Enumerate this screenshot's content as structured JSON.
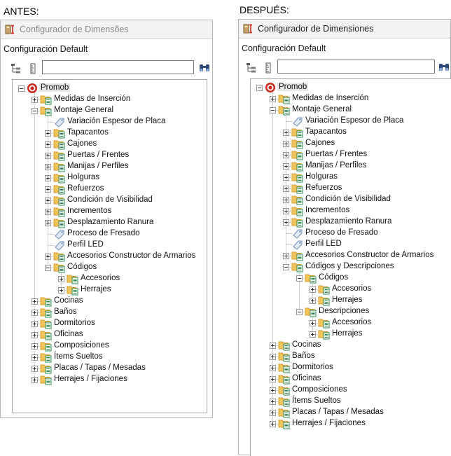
{
  "labels": {
    "before": "ANTES:",
    "after": "DESPUÉS:"
  },
  "window_title": "Configurador de Dimensões",
  "window_title_after": "Configurador de Dimensiones",
  "section_label": "Configuración Default",
  "search": {
    "value": "",
    "placeholder": ""
  },
  "toolbar": {
    "left_icon": "tree-structure-icon",
    "middle_icon": "ruler-icon",
    "find_icon": "binoculars-icon"
  },
  "colors": {
    "folder": "#f2c55c",
    "folder_dark": "#d39e2c",
    "doc_green": "#2d8a4e",
    "root_red": "#d0281c",
    "tag_blue": "#6f8fb8"
  },
  "before_tree": [
    {
      "depth": 0,
      "label": "Promob",
      "type": "root",
      "exp": "minus"
    },
    {
      "depth": 1,
      "label": "Medidas de Inserción",
      "type": "folder",
      "exp": "plus"
    },
    {
      "depth": 1,
      "label": "Montaje General",
      "type": "folder",
      "exp": "minus"
    },
    {
      "depth": 2,
      "label": "Variación Espesor de Placa",
      "type": "tag",
      "exp": ""
    },
    {
      "depth": 2,
      "label": "Tapacantos",
      "type": "folder",
      "exp": "plus"
    },
    {
      "depth": 2,
      "label": "Cajones",
      "type": "folder",
      "exp": "plus"
    },
    {
      "depth": 2,
      "label": "Puertas / Frentes",
      "type": "folder",
      "exp": "plus"
    },
    {
      "depth": 2,
      "label": "Manijas / Perfiles",
      "type": "folder",
      "exp": "plus"
    },
    {
      "depth": 2,
      "label": "Holguras",
      "type": "folder",
      "exp": "plus"
    },
    {
      "depth": 2,
      "label": "Refuerzos",
      "type": "folder",
      "exp": "plus"
    },
    {
      "depth": 2,
      "label": "Condición de Visibilidad",
      "type": "folder",
      "exp": "plus"
    },
    {
      "depth": 2,
      "label": "Incrementos",
      "type": "folder",
      "exp": "plus"
    },
    {
      "depth": 2,
      "label": "Desplazamiento Ranura",
      "type": "folder",
      "exp": "plus"
    },
    {
      "depth": 2,
      "label": "Proceso de Fresado",
      "type": "tag",
      "exp": ""
    },
    {
      "depth": 2,
      "label": "Perfil LED",
      "type": "tag",
      "exp": ""
    },
    {
      "depth": 2,
      "label": "Accesorios Constructor de Armarios",
      "type": "folder",
      "exp": "plus"
    },
    {
      "depth": 2,
      "label": "Códigos",
      "type": "folder",
      "exp": "minus"
    },
    {
      "depth": 3,
      "label": "Accesorios",
      "type": "folder",
      "exp": "plus"
    },
    {
      "depth": 3,
      "label": "Herrajes",
      "type": "folder",
      "exp": "plus"
    },
    {
      "depth": 1,
      "label": "Cocinas",
      "type": "folder",
      "exp": "plus"
    },
    {
      "depth": 1,
      "label": "Baños",
      "type": "folder",
      "exp": "plus"
    },
    {
      "depth": 1,
      "label": "Dormitorios",
      "type": "folder",
      "exp": "plus"
    },
    {
      "depth": 1,
      "label": "Oficinas",
      "type": "folder",
      "exp": "plus"
    },
    {
      "depth": 1,
      "label": "Composiciones",
      "type": "folder",
      "exp": "plus"
    },
    {
      "depth": 1,
      "label": "Ítems Sueltos",
      "type": "folder",
      "exp": "plus"
    },
    {
      "depth": 1,
      "label": "Placas / Tapas / Mesadas",
      "type": "folder",
      "exp": "plus"
    },
    {
      "depth": 1,
      "label": "Herrajes / Fijaciones",
      "type": "folder",
      "exp": "plus"
    }
  ],
  "after_tree": [
    {
      "depth": 0,
      "label": "Promob",
      "type": "root",
      "exp": "minus"
    },
    {
      "depth": 1,
      "label": "Medidas de Inserción",
      "type": "folder",
      "exp": "plus"
    },
    {
      "depth": 1,
      "label": "Montaje General",
      "type": "folder",
      "exp": "minus"
    },
    {
      "depth": 2,
      "label": "Variación Espesor de Placa",
      "type": "tag",
      "exp": ""
    },
    {
      "depth": 2,
      "label": "Tapacantos",
      "type": "folder",
      "exp": "plus"
    },
    {
      "depth": 2,
      "label": "Cajones",
      "type": "folder",
      "exp": "plus"
    },
    {
      "depth": 2,
      "label": "Puertas / Frentes",
      "type": "folder",
      "exp": "plus"
    },
    {
      "depth": 2,
      "label": "Manijas / Perfiles",
      "type": "folder",
      "exp": "plus"
    },
    {
      "depth": 2,
      "label": "Holguras",
      "type": "folder",
      "exp": "plus"
    },
    {
      "depth": 2,
      "label": "Refuerzos",
      "type": "folder",
      "exp": "plus"
    },
    {
      "depth": 2,
      "label": "Condición de Visibilidad",
      "type": "folder",
      "exp": "plus"
    },
    {
      "depth": 2,
      "label": "Incrementos",
      "type": "folder",
      "exp": "plus"
    },
    {
      "depth": 2,
      "label": "Desplazamiento Ranura",
      "type": "folder",
      "exp": "plus"
    },
    {
      "depth": 2,
      "label": "Proceso de Fresado",
      "type": "tag",
      "exp": ""
    },
    {
      "depth": 2,
      "label": "Perfil LED",
      "type": "tag",
      "exp": ""
    },
    {
      "depth": 2,
      "label": "Accesorios Constructor de Armarios",
      "type": "folder",
      "exp": "plus"
    },
    {
      "depth": 2,
      "label": "Códigos y Descripciones",
      "type": "folder",
      "exp": "minus"
    },
    {
      "depth": 3,
      "label": "Códigos",
      "type": "folder",
      "exp": "minus"
    },
    {
      "depth": 4,
      "label": "Accesorios",
      "type": "folder",
      "exp": "plus"
    },
    {
      "depth": 4,
      "label": "Herrajes",
      "type": "folder",
      "exp": "plus"
    },
    {
      "depth": 3,
      "label": "Descripciones",
      "type": "folder",
      "exp": "minus"
    },
    {
      "depth": 4,
      "label": "Accesorios",
      "type": "folder",
      "exp": "plus"
    },
    {
      "depth": 4,
      "label": "Herrajes",
      "type": "folder",
      "exp": "plus"
    },
    {
      "depth": 1,
      "label": "Cocinas",
      "type": "folder",
      "exp": "plus"
    },
    {
      "depth": 1,
      "label": "Baños",
      "type": "folder",
      "exp": "plus"
    },
    {
      "depth": 1,
      "label": "Dormitorios",
      "type": "folder",
      "exp": "plus"
    },
    {
      "depth": 1,
      "label": "Oficinas",
      "type": "folder",
      "exp": "plus"
    },
    {
      "depth": 1,
      "label": "Composiciones",
      "type": "folder",
      "exp": "plus"
    },
    {
      "depth": 1,
      "label": "Ítems Sueltos",
      "type": "folder",
      "exp": "plus"
    },
    {
      "depth": 1,
      "label": "Placas / Tapas / Mesadas",
      "type": "folder",
      "exp": "plus"
    },
    {
      "depth": 1,
      "label": "Herrajes / Fijaciones",
      "type": "folder",
      "exp": "plus"
    }
  ]
}
